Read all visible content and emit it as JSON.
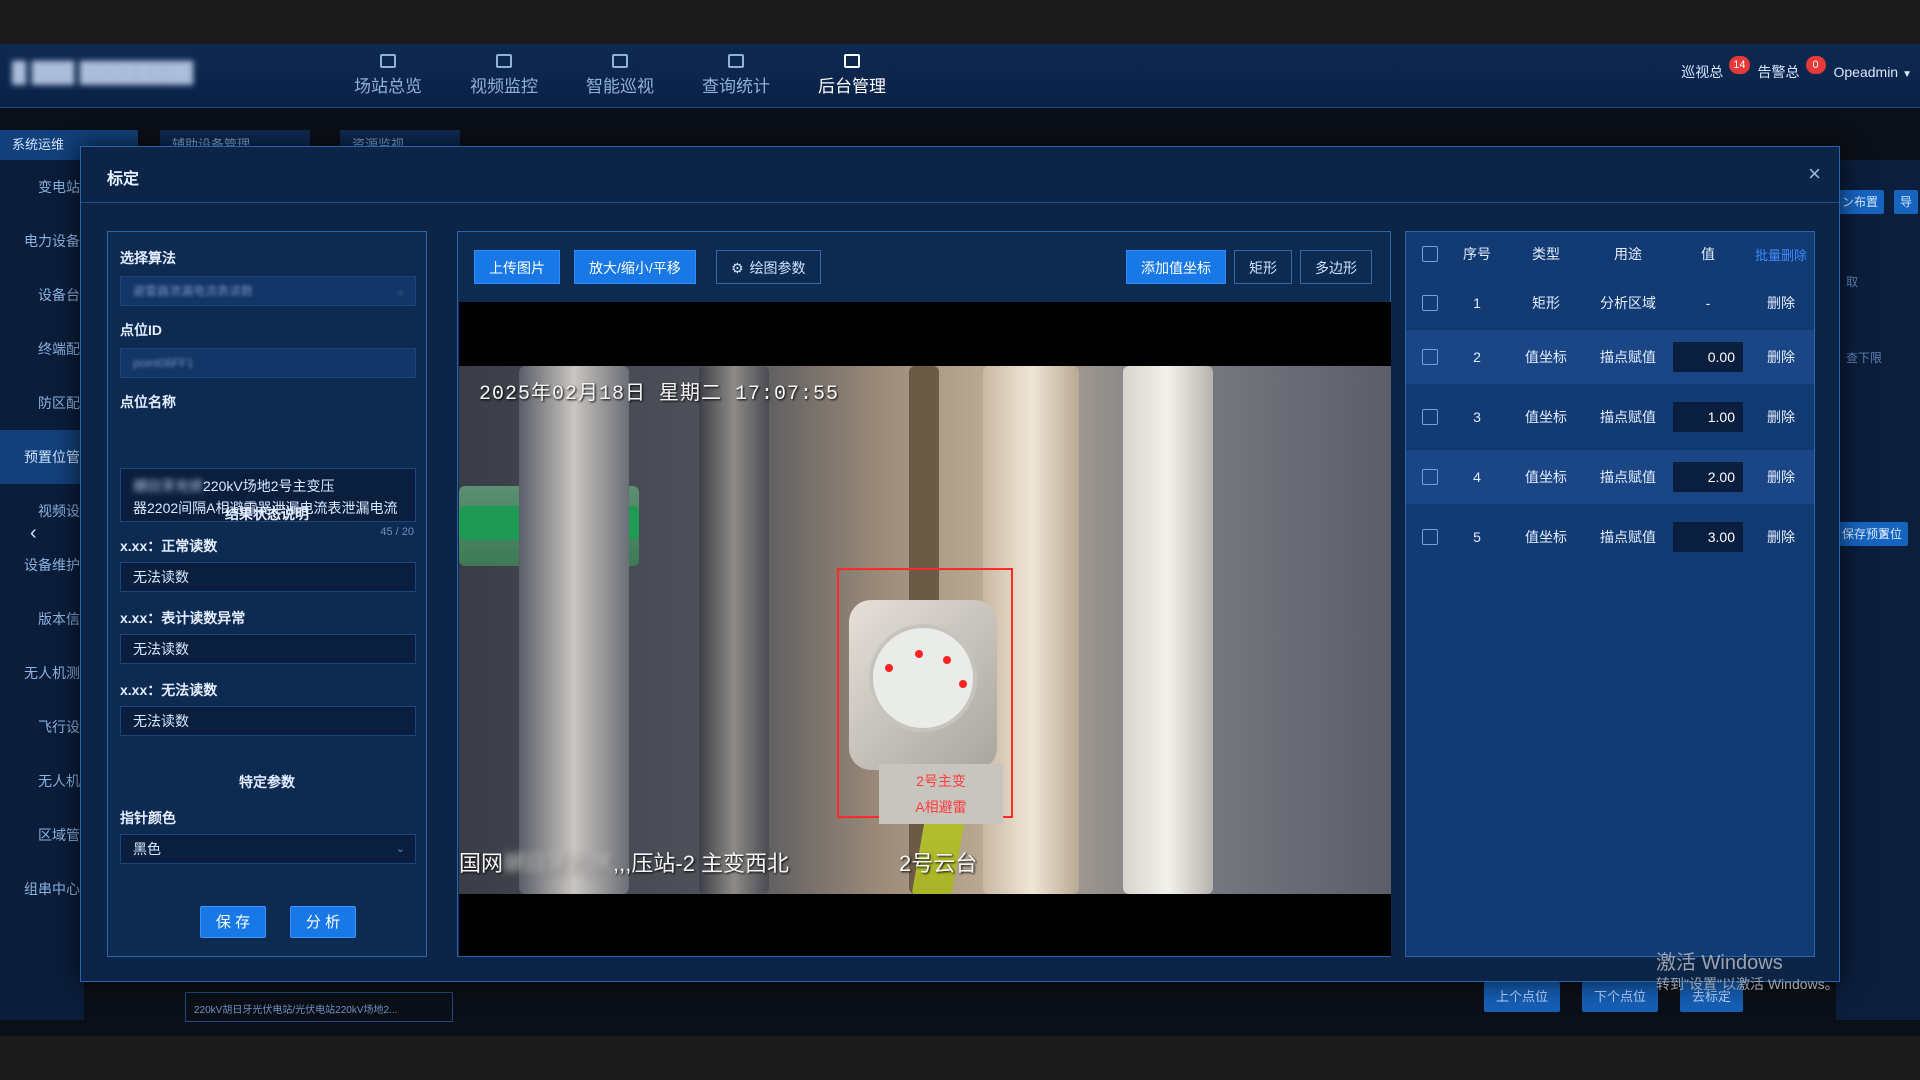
{
  "header": {
    "logo": "█ ███ ████████",
    "nav": [
      {
        "label": "场站总览",
        "active": false
      },
      {
        "label": "视频监控",
        "active": false
      },
      {
        "label": "智能巡视",
        "active": false
      },
      {
        "label": "查询统计",
        "active": false
      },
      {
        "label": "后台管理",
        "active": true
      }
    ],
    "alerts": {
      "inspect_label": "巡视总",
      "inspect_count": "14",
      "alarm_label": "告警总",
      "alarm_count": "0"
    },
    "user": "Opeadmin"
  },
  "background": {
    "tabs": [
      "系统运维",
      "辅助设备管理",
      "资源监视"
    ],
    "sidebar": [
      "变电站",
      "电力设备",
      "设备台",
      "终端配",
      "防区配",
      "预置位管",
      "视频设",
      "设备维护",
      "版本信",
      "无人机测",
      "飞行设",
      "无人机",
      "区域管",
      "组串中心"
    ],
    "bottom_select": "220kV胡日牙光伏电站/光伏电站220kV场地2...",
    "right_buttons": [
      "ン布置",
      "导",
      "取",
      "查下限",
      "保存预置位"
    ],
    "bottom_buttons": [
      "上个点位",
      "下个点位",
      "去标定"
    ]
  },
  "modal": {
    "title": "标定",
    "close": "×",
    "left": {
      "algo_label": "选择算法",
      "algo_value": "避雷器泄漏电流表读数",
      "point_id_label": "点位ID",
      "point_id_value": "point06FF1",
      "point_name_label": "点位名称",
      "point_name_blur": "胡日牙光伏",
      "point_name_line1_rest": "220kV场地2号主变压",
      "point_name_line2": "器2202间隔A相避雷器泄漏电流表泄漏电流",
      "counter": "45 / 20",
      "result_title": "结果状态说明",
      "status1_label": "x.xx：正常读数",
      "status1_value": "无法读数",
      "status2_label": "x.xx：表计读数异常",
      "status2_value": "无法读数",
      "status3_label": "x.xx：无法读数",
      "status3_value": "无法读数",
      "params_title": "特定参数",
      "pointer_color_label": "指针颜色",
      "pointer_color_value": "黑色",
      "save_btn": "保 存",
      "analyze_btn": "分 析"
    },
    "center": {
      "upload_btn": "上传图片",
      "zoom_btn": "放大/缩小/平移",
      "draw_params_btn": "绘图参数",
      "add_coord_btn": "添加值坐标",
      "rect_btn": "矩形",
      "polygon_btn": "多边形",
      "video_time": "2025年02月18日 星期二 17:07:55",
      "cam_left_prefix": "国网",
      "cam_left_blur": "胡日牙光伏",
      "cam_left_rest": ",,,压站-2 主变西北",
      "cam_right": "2号云台",
      "tag_line1": "2号主变",
      "tag_line2": "A相避雷"
    },
    "right": {
      "headers": {
        "index": "序号",
        "type": "类型",
        "usage": "用途",
        "value": "值",
        "batch_delete": "批量删除"
      },
      "rows": [
        {
          "index": "1",
          "type": "矩形",
          "usage": "分析区域",
          "value": "-",
          "action": "删除"
        },
        {
          "index": "2",
          "type": "值坐标",
          "usage": "描点赋值",
          "value": "0.00",
          "action": "删除"
        },
        {
          "index": "3",
          "type": "值坐标",
          "usage": "描点赋值",
          "value": "1.00",
          "action": "删除"
        },
        {
          "index": "4",
          "type": "值坐标",
          "usage": "描点赋值",
          "value": "2.00",
          "action": "删除"
        },
        {
          "index": "5",
          "type": "值坐标",
          "usage": "描点赋值",
          "value": "3.00",
          "action": "删除"
        }
      ]
    }
  },
  "watermark": {
    "line1": "激活 Windows",
    "line2": "转到\"设置\"以激活 Windows。"
  }
}
